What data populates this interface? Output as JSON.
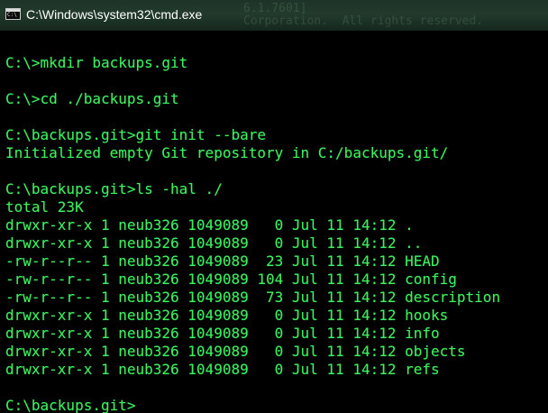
{
  "window": {
    "title": "C:\\Windows\\system32\\cmd.exe",
    "background_title_text": "6.1.7601]\nCorporation.  All rights reserved.",
    "text_color": "#3cf060",
    "background_color": "#000000"
  },
  "console": {
    "lines": [
      "",
      "C:\\>mkdir backups.git",
      "",
      "C:\\>cd ./backups.git",
      "",
      "C:\\backups.git>git init --bare",
      "Initialized empty Git repository in C:/backups.git/",
      "",
      "C:\\backups.git>ls -hal ./",
      "total 23K",
      "drwxr-xr-x 1 neub326 1049089   0 Jul 11 14:12 .",
      "drwxr-xr-x 1 neub326 1049089   0 Jul 11 14:12 ..",
      "-rw-r--r-- 1 neub326 1049089  23 Jul 11 14:12 HEAD",
      "-rw-r--r-- 1 neub326 1049089 104 Jul 11 14:12 config",
      "-rw-r--r-- 1 neub326 1049089  73 Jul 11 14:12 description",
      "drwxr-xr-x 1 neub326 1049089   0 Jul 11 14:12 hooks",
      "drwxr-xr-x 1 neub326 1049089   0 Jul 11 14:12 info",
      "drwxr-xr-x 1 neub326 1049089   0 Jul 11 14:12 objects",
      "drwxr-xr-x 1 neub326 1049089   0 Jul 11 14:12 refs",
      "",
      "C:\\backups.git>"
    ]
  }
}
